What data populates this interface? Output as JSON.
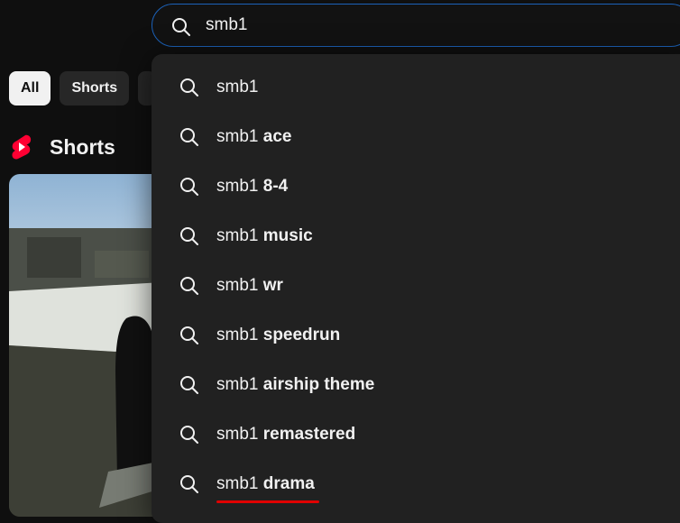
{
  "search": {
    "value": "smb1",
    "icon": "search-icon"
  },
  "chips": [
    {
      "label": "All",
      "active": true
    },
    {
      "label": "Shorts",
      "active": false
    }
  ],
  "shorts_section": {
    "title": "Shorts",
    "logo": "youtube-shorts-icon",
    "logo_color": "#ff0033"
  },
  "suggestions": [
    {
      "prefix": "smb1",
      "rest": ""
    },
    {
      "prefix": "smb1",
      "rest": " ace"
    },
    {
      "prefix": "smb1",
      "rest": " 8-4"
    },
    {
      "prefix": "smb1",
      "rest": " music"
    },
    {
      "prefix": "smb1",
      "rest": " wr"
    },
    {
      "prefix": "smb1",
      "rest": " speedrun"
    },
    {
      "prefix": "smb1",
      "rest": " airship theme"
    },
    {
      "prefix": "smb1",
      "rest": " remastered"
    },
    {
      "prefix": "smb1",
      "rest": " drama"
    }
  ],
  "colors": {
    "background": "#0f0f0f",
    "dropdown": "#212121",
    "search_border": "#1c62b9",
    "spellcheck_underline": "#e00000"
  }
}
